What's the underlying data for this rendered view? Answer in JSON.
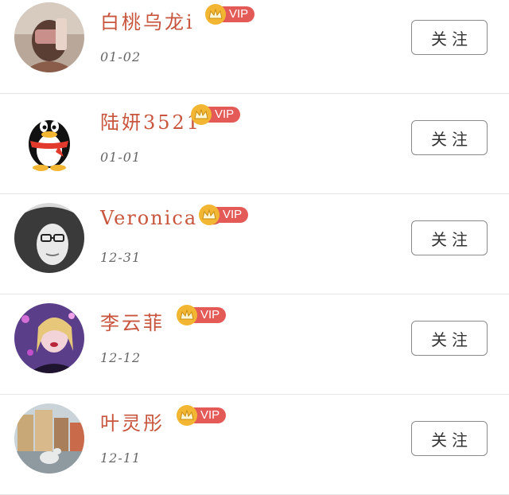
{
  "users": [
    {
      "name": "白桃乌龙i",
      "date": "01-02",
      "vip_label": "VIP",
      "follow_label": "关注",
      "avatar": "photo-avatar"
    },
    {
      "name": "陆妍3521",
      "date": "01-01",
      "vip_label": "VIP",
      "follow_label": "关注",
      "avatar": "qq-penguin-avatar"
    },
    {
      "name": "Veronica G",
      "date": "12-31",
      "vip_label": "VIP",
      "follow_label": "关注",
      "avatar": "photo-avatar"
    },
    {
      "name": "李云菲",
      "date": "12-12",
      "vip_label": "VIP",
      "follow_label": "关注",
      "avatar": "photo-avatar"
    },
    {
      "name": "叶灵彤",
      "date": "12-11",
      "vip_label": "VIP",
      "follow_label": "关注",
      "avatar": "photo-avatar"
    }
  ],
  "colors": {
    "name": "#c8553d",
    "vip_pill": "#e45a56",
    "vip_crown": "#f2b632",
    "date": "#666666",
    "button_border": "#8a8a8a",
    "divider": "#e6e6e6"
  },
  "icons": {
    "vip": "crown-icon"
  }
}
